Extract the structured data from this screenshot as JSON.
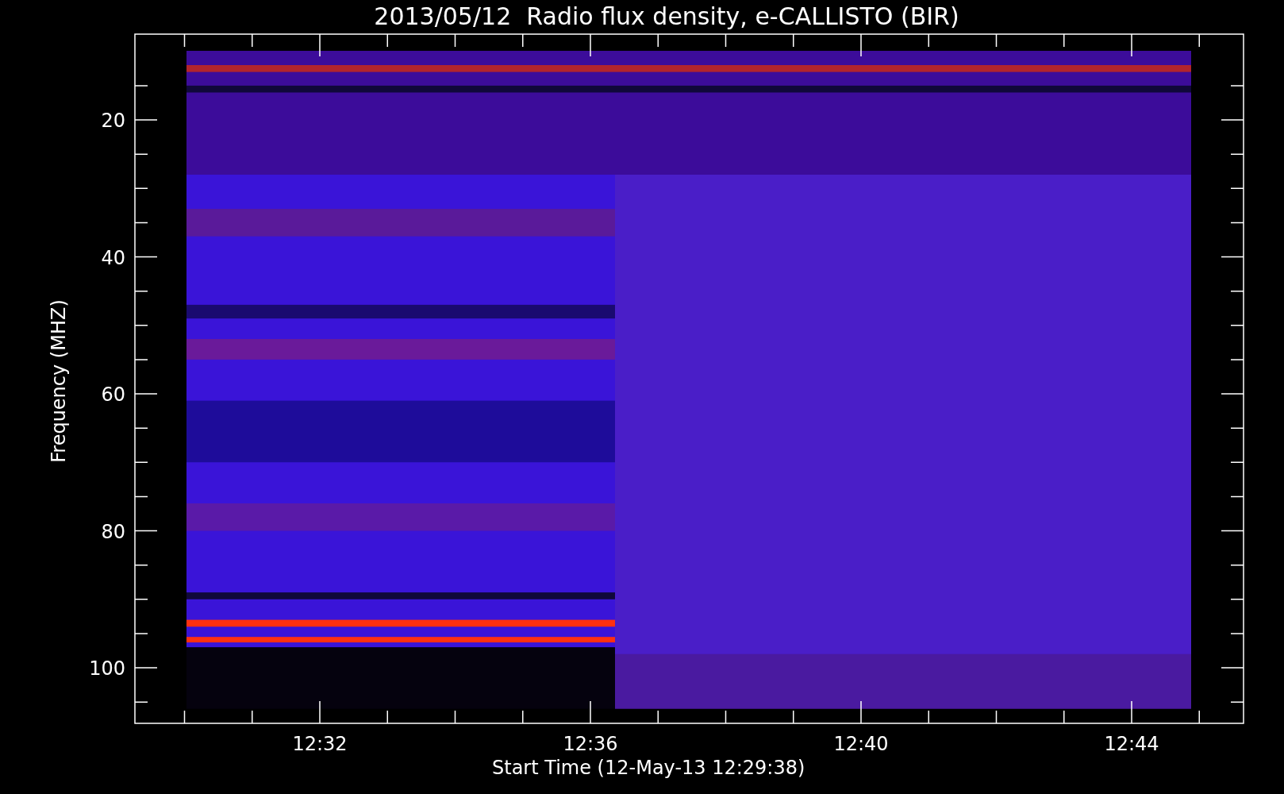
{
  "title": "2013/05/12  Radio flux density, e-CALLISTO (BIR)",
  "y_axis": {
    "label": "Frequency (MHZ)",
    "ticks": [
      "20",
      "40",
      "60",
      "80",
      "100"
    ]
  },
  "x_axis": {
    "label": "Start Time (12-May-13 12:29:38)",
    "ticks": [
      "12:32",
      "12:36",
      "12:40",
      "12:44"
    ]
  }
}
